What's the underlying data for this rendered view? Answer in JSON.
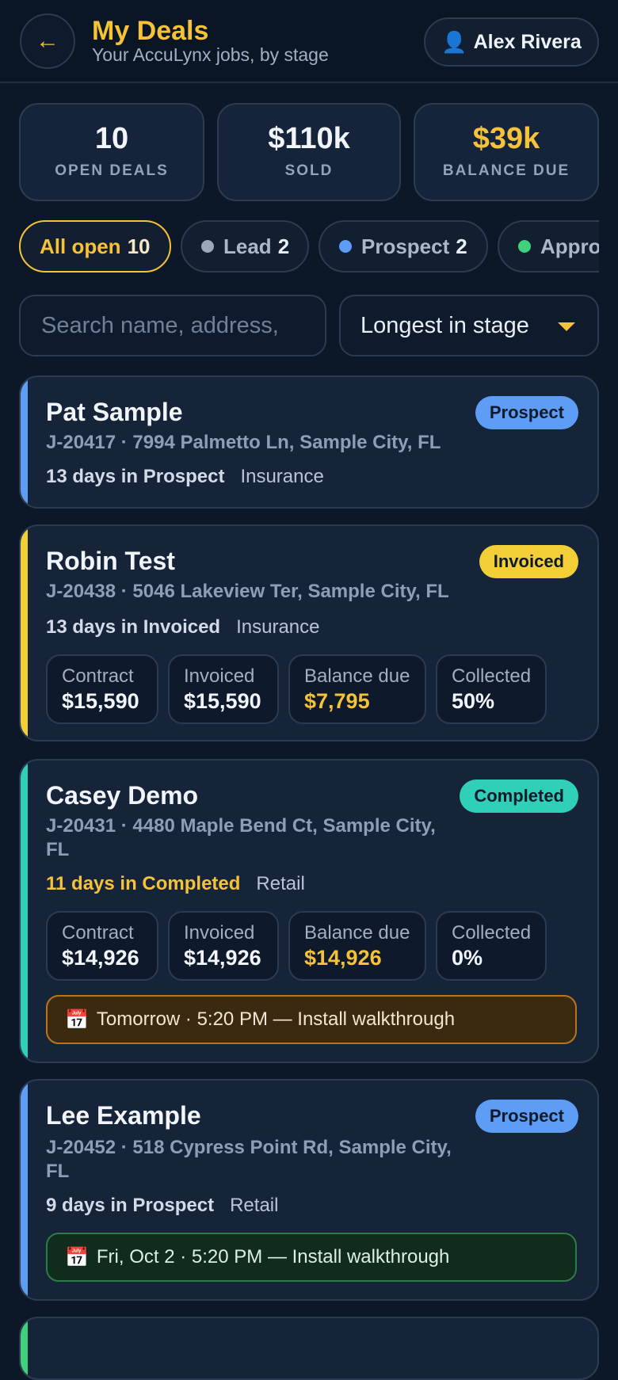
{
  "header": {
    "back_glyph": "←",
    "title": "My Deals",
    "subtitle": "Your AccuLynx jobs, by stage",
    "user_icon": "person-icon",
    "user_glyph": "👤",
    "user_name": "Alex Rivera"
  },
  "stats": [
    {
      "value": "10",
      "label": "OPEN DEALS"
    },
    {
      "value": "$110k",
      "label": "SOLD"
    },
    {
      "value": "$39k",
      "label": "BALANCE DUE"
    }
  ],
  "filters": [
    {
      "label": "All open",
      "count": "10",
      "active": true
    },
    {
      "label": "Lead",
      "count": "2",
      "dot_color": "#9aa8bb"
    },
    {
      "label": "Prospect",
      "count": "2",
      "dot_color": "#5e9df5"
    },
    {
      "label": "Appro",
      "count": "",
      "dot_color": "#3fd27a"
    }
  ],
  "search": {
    "placeholder": "Search name, address,"
  },
  "sort": {
    "value": "Longest in stage"
  },
  "colors": {
    "accent": "#f5c238",
    "prospect": "#5e9df5",
    "invoiced": "#f2cf36",
    "completed": "#2fcfb8",
    "approved": "#3fd27a"
  },
  "deals": [
    {
      "name": "Pat Sample",
      "badge": "Prospect",
      "address": "J-20417 · 7994 Palmetto Ln, Sample City, FL",
      "days": "13 days in Prospect",
      "type": "Insurance"
    },
    {
      "name": "Robin Test",
      "badge": "Invoiced",
      "address": "J-20438 · 5046 Lakeview Ter, Sample City, FL",
      "days": "13 days in Invoiced",
      "type": "Insurance",
      "metrics": [
        {
          "label": "Contract",
          "value": "$15,590"
        },
        {
          "label": "Invoiced",
          "value": "$15,590"
        },
        {
          "label": "Balance due",
          "value": "$7,795"
        },
        {
          "label": "Collected",
          "value": "50%"
        }
      ]
    },
    {
      "name": "Casey Demo",
      "badge": "Completed",
      "address": "J-20431 · 4480 Maple Bend Ct, Sample City, FL",
      "days": "11 days in Completed",
      "type": "Retail",
      "metrics": [
        {
          "label": "Contract",
          "value": "$14,926"
        },
        {
          "label": "Invoiced",
          "value": "$14,926"
        },
        {
          "label": "Balance due",
          "value": "$14,926"
        },
        {
          "label": "Collected",
          "value": "0%"
        }
      ],
      "appointment": "Tomorrow · 5:20 PM — Install walkthrough"
    },
    {
      "name": "Lee Example",
      "badge": "Prospect",
      "address": "J-20452 · 518 Cypress Point Rd, Sample City, FL",
      "days": "9 days in Prospect",
      "type": "Retail",
      "appointment": "Fri, Oct 2 · 5:20 PM — Install walkthrough"
    }
  ],
  "calendar_icon": "calendar-icon",
  "calendar_glyph": "📅"
}
